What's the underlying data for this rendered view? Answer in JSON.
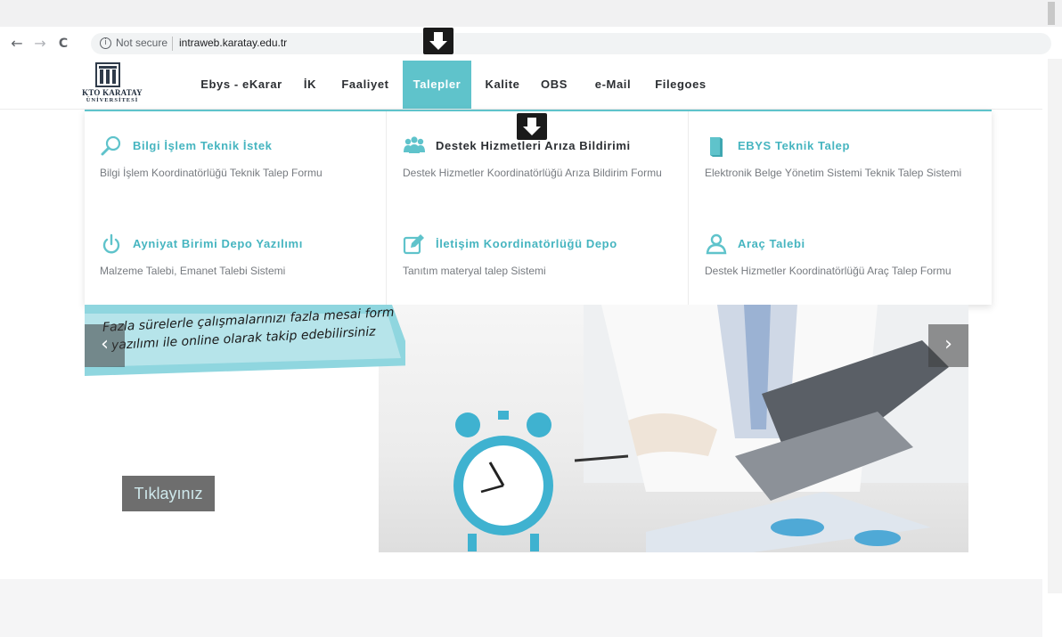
{
  "browser": {
    "nav": {
      "back": "←",
      "forward": "→",
      "reload": "C"
    },
    "security_label": "Not secure",
    "url": "intraweb.karatay.edu.tr"
  },
  "site": {
    "logo": {
      "line1": "KTO KARATAY",
      "line2": "ÜNİVERSİTESİ"
    },
    "menu": [
      {
        "label": "Ebys - eKarar"
      },
      {
        "label": "İK"
      },
      {
        "label": "Faaliyet"
      },
      {
        "label": "Talepler",
        "active": true
      },
      {
        "label": "Kalite"
      },
      {
        "label": "OBS"
      },
      {
        "label": "e-Mail"
      },
      {
        "label": "Filegoes"
      }
    ]
  },
  "dropdown": {
    "items": [
      {
        "title": "Bilgi İşlem Teknik İstek",
        "desc": "Bilgi İşlem Koordinatörlüğü Teknik Talep Formu",
        "icon": "search-icon"
      },
      {
        "title": "Destek Hizmetleri Arıza Bildirimi",
        "desc": "Destek Hizmetler Koordinatörlüğü Arıza Bildirim Formu",
        "icon": "users-icon"
      },
      {
        "title": "EBYS Teknik Talep",
        "desc": "Elektronik Belge Yönetim Sistemi Teknik Talep Sistemi",
        "icon": "document-icon"
      },
      {
        "title": "Ayniyat Birimi Depo Yazılımı",
        "desc": "Malzeme Talebi, Emanet Talebi Sistemi",
        "icon": "power-icon"
      },
      {
        "title": "İletişim Koordinatörlüğü Depo",
        "desc": "Tanıtım materyal talep Sistemi",
        "icon": "edit-icon"
      },
      {
        "title": "Araç Talebi",
        "desc": "Destek Hizmetler Koordinatörlüğü Araç Talep Formu",
        "icon": "user-icon"
      }
    ]
  },
  "slider": {
    "banner_line1": "Fazla sürelerle çalışmalarınızı fazla mesai form",
    "banner_line2": "yazılımı ile online olarak takip edebilirsiniz",
    "prev": "‹",
    "next": "›",
    "cta": "Tıklayınız"
  },
  "colors": {
    "accent": "#5fc3cb",
    "text_dark": "#2c2f33",
    "text_muted": "#777b80"
  }
}
